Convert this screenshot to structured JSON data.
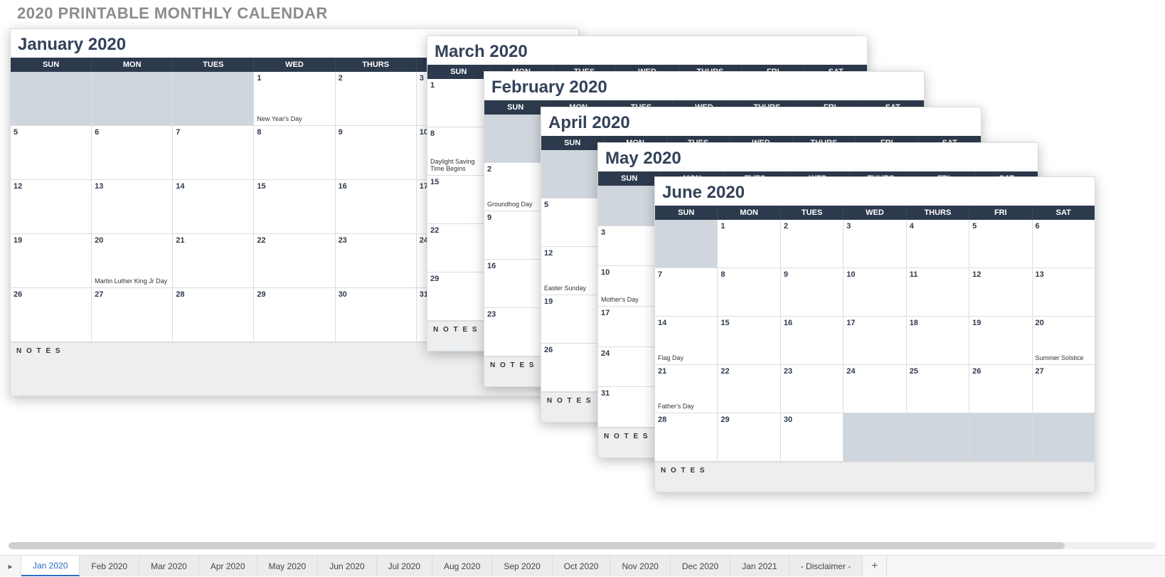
{
  "page_title": "2020 PRINTABLE MONTHLY CALENDAR",
  "dow": [
    "SUN",
    "MON",
    "TUES",
    "WED",
    "THURS",
    "FRI",
    "SAT"
  ],
  "notes_label": "N O T E S",
  "months": {
    "jan": {
      "title": "January 2020",
      "start": 3,
      "days": 31,
      "events": {
        "1": "New Year's Day",
        "20": "Martin Luther King Jr Day"
      }
    },
    "feb": {
      "title": "February 2020",
      "start": 6,
      "days": 29,
      "events": {
        "2": "Groundhog Day"
      }
    },
    "mar": {
      "title": "March 2020",
      "start": 0,
      "days": 31,
      "events": {
        "8": "Daylight Saving Time Begins"
      }
    },
    "apr": {
      "title": "April 2020",
      "start": 3,
      "days": 30,
      "events": {
        "12": "Easter Sunday"
      }
    },
    "may": {
      "title": "May 2020",
      "start": 5,
      "days": 31,
      "events": {
        "10": "Mother's Day"
      }
    },
    "jun": {
      "title": "June 2020",
      "start": 1,
      "days": 30,
      "events": {
        "14": "Flag Day",
        "20": "Summer Solstice",
        "21": "Father's Day"
      }
    }
  },
  "tabs": [
    "Jan 2020",
    "Feb 2020",
    "Mar 2020",
    "Apr 2020",
    "May 2020",
    "Jun 2020",
    "Jul 2020",
    "Aug 2020",
    "Sep 2020",
    "Oct 2020",
    "Nov 2020",
    "Dec 2020",
    "Jan 2021",
    "- Disclaimer -"
  ],
  "active_tab": 0
}
